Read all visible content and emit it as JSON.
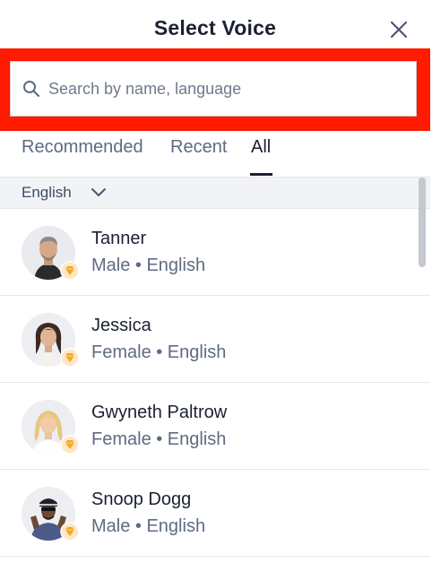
{
  "header": {
    "title": "Select Voice",
    "close_icon": "close-icon"
  },
  "search": {
    "placeholder": "Search by name, language",
    "value": "",
    "icon": "search-icon",
    "highlight_color": "#ff1a00"
  },
  "tabs": [
    {
      "label": "Recommended",
      "active": false
    },
    {
      "label": "Recent",
      "active": false
    },
    {
      "label": "All",
      "active": true
    }
  ],
  "filter": {
    "label": "English",
    "icon": "chevron-down-icon"
  },
  "voices": [
    {
      "name": "Tanner",
      "meta": "Male • English",
      "premium": true
    },
    {
      "name": "Jessica",
      "meta": "Female • English",
      "premium": true
    },
    {
      "name": "Gwyneth Paltrow",
      "meta": "Female • English",
      "premium": true
    },
    {
      "name": "Snoop Dogg",
      "meta": "Male • English",
      "premium": true
    }
  ],
  "colors": {
    "accent_text": "#1b2132",
    "muted_text": "#5e6b82",
    "badge": "#f5a623"
  }
}
